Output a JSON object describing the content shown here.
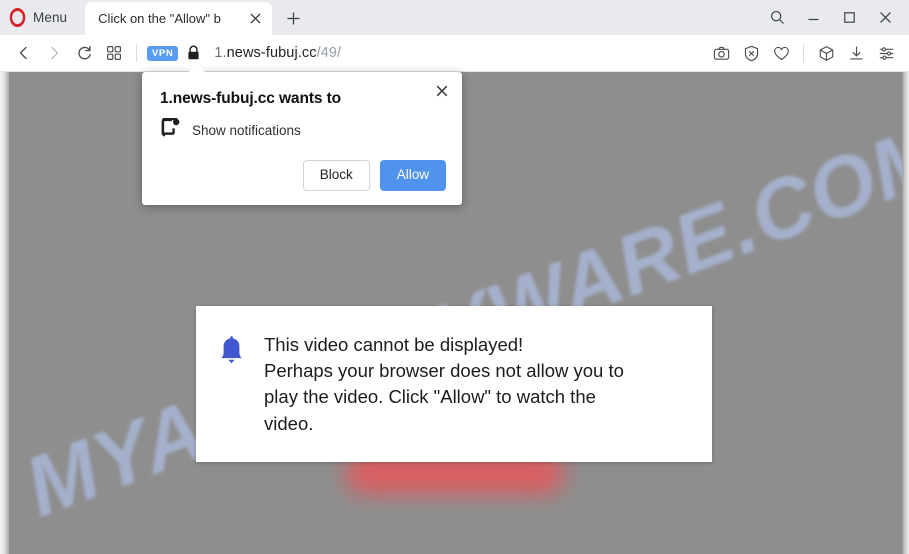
{
  "browser": {
    "menu_label": "Menu",
    "logo_name": "opera-logo",
    "brand_color": "#d6232c",
    "tab": {
      "title": "Click on the \"Allow\" b",
      "close_glyph": "✕"
    },
    "new_tab_glyph": "+",
    "window_controls": {
      "search_glyph": "search-icon",
      "minimize_glyph": "minimize-icon",
      "maximize_glyph": "maximize-icon",
      "close_glyph": "close-icon"
    },
    "navigation": {
      "back_glyph": "back-icon",
      "forward_glyph": "forward-icon",
      "reload_glyph": "reload-icon",
      "tiles_glyph": "speed-dial-icon"
    },
    "address": {
      "vpn_badge": "VPN",
      "vpn_color": "#5a9cf0",
      "lock_state": "secure",
      "url_subdomain": "1.",
      "url_domain": "news-fubuj.cc",
      "url_path": "/49/",
      "url_full": "1.news-fubuj.cc/49/"
    },
    "toolbar_right": [
      {
        "name": "snapshot-icon",
        "label": "Snapshot"
      },
      {
        "name": "ad-blocker-icon",
        "label": "Ad blocker"
      },
      {
        "name": "favorites-icon",
        "label": "Favorites"
      },
      {
        "name": "crypto-wallet-icon",
        "label": "Crypto Wallet"
      },
      {
        "name": "downloads-icon",
        "label": "Downloads"
      },
      {
        "name": "easy-setup-icon",
        "label": "Easy setup"
      }
    ]
  },
  "permission_dialog": {
    "title": "1.news-fubuj.cc wants to",
    "permission_icon": "notifications-icon",
    "permission_label": "Show notifications",
    "block_label": "Block",
    "allow_label": "Allow",
    "allow_color": "#4f93ec",
    "close_glyph": "✕"
  },
  "page": {
    "background_color": "#8e8e8e",
    "watermark": "MYANTISPYWARE.COM",
    "watermark_color": "#aebee4",
    "card": {
      "icon": "bell-icon",
      "icon_color": "#4258d0",
      "line1": "This video cannot be displayed!",
      "line2": "Perhaps your browser does not allow you to",
      "line3": "play the video. Click \"Allow\" to watch the",
      "line4": "video.",
      "text": "This video cannot be displayed! Perhaps your browser does not allow you to play the video. Click \"Allow\" to watch the video."
    }
  }
}
